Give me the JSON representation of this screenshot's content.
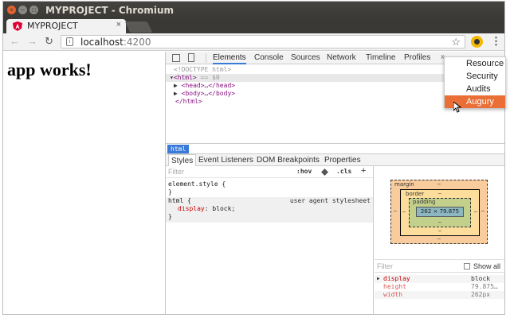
{
  "window": {
    "title": "MYPROJECT - Chromium"
  },
  "tab": {
    "title": "MYPROJECT",
    "close_label": "×"
  },
  "toolbar": {
    "url_host": "localhost",
    "url_port": ":4200"
  },
  "page": {
    "heading": "app works!"
  },
  "devtools": {
    "tabs": [
      "Elements",
      "Console",
      "Sources",
      "Network",
      "Timeline",
      "Profiles"
    ],
    "more_label": "»",
    "dom": {
      "doctype": "<!DOCTYPE html>",
      "html_open": "<html>",
      "html_suffix": " == $0",
      "head": "<head>…</head>",
      "body": "<body>…</body>",
      "html_close": "</html>"
    },
    "breadcrumb": "html",
    "subtabs": [
      "Styles",
      "Event Listeners",
      "DOM Breakpoints",
      "Properties"
    ],
    "styles": {
      "filter_placeholder": "Filter",
      "hov": ":hov",
      "cls": ".cls",
      "plus": "+",
      "element_style_open": "element.style {",
      "element_style_close": "}",
      "html_rule_open": "html {",
      "html_rule_source": "user agent stylesheet",
      "html_rule_prop": "display",
      "html_rule_value": "block;",
      "html_rule_close": "}"
    },
    "boxmodel": {
      "margin_label": "margin",
      "border_label": "border",
      "padding_label": "padding",
      "content": "262 × 79.875",
      "dash": "–"
    },
    "computed": {
      "filter_placeholder": "Filter",
      "show_all": "Show all",
      "rows": [
        {
          "name": "display",
          "value": "block"
        },
        {
          "name": "height",
          "value": "79.875…"
        },
        {
          "name": "width",
          "value": "262px"
        }
      ]
    },
    "menu": {
      "items": [
        "Resource",
        "Security",
        "Audits",
        "Augury"
      ],
      "highlighted": "Augury"
    }
  },
  "colors": {
    "accent": "#e96f36",
    "devtools_blue": "#3879d9",
    "angular_red": "#dd0031"
  }
}
